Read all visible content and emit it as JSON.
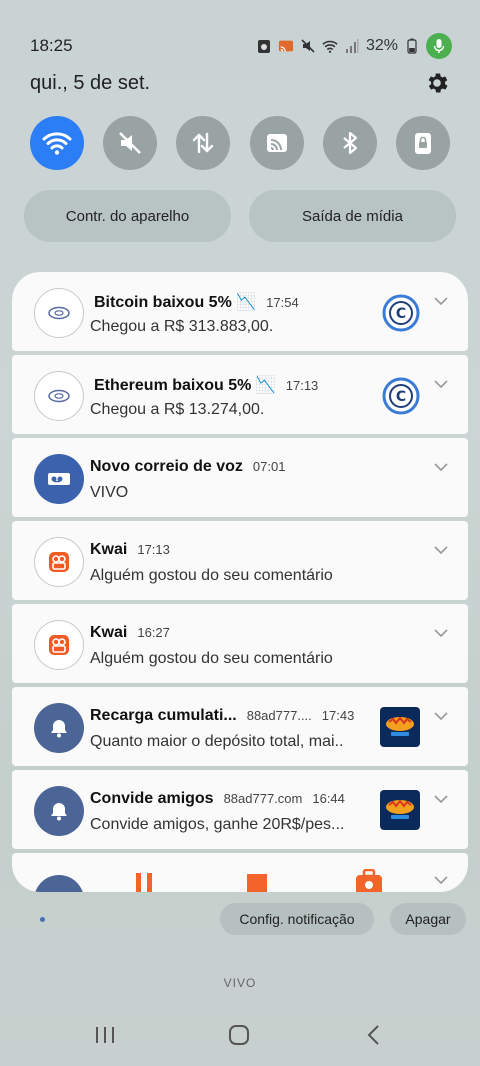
{
  "status": {
    "time": "18:25",
    "battery": "32%",
    "colors": {
      "mic": "#4caf50"
    }
  },
  "header": {
    "date": "qui., 5 de set."
  },
  "quick_settings": {
    "tiles": [
      {
        "name": "wifi",
        "active": true
      },
      {
        "name": "sound-off",
        "active": false
      },
      {
        "name": "mobile-data",
        "active": false
      },
      {
        "name": "cast",
        "active": false
      },
      {
        "name": "bluetooth",
        "active": false
      },
      {
        "name": "lock-rotation",
        "active": false
      }
    ],
    "device_control_label": "Contr. do aparelho",
    "media_output_label": "Saída de mídia"
  },
  "notifications": [
    {
      "title": "Bitcoin baixou 5% 📉",
      "time": "17:54",
      "body": "Chegou a R$ 313.883,00.",
      "icon": "coin-app-icon"
    },
    {
      "title": "Ethereum baixou 5% 📉",
      "time": "17:13",
      "body": "Chegou a R$ 13.274,00.",
      "icon": "coin-app-icon"
    },
    {
      "title": "Novo correio de voz",
      "time": "07:01",
      "body": "VIVO",
      "icon": "voicemail-icon"
    },
    {
      "title": "Kwai",
      "time": "17:13",
      "body": "Alguém gostou do seu comentário",
      "icon": "kwai-icon"
    },
    {
      "title": "Kwai",
      "time": "16:27",
      "body": "Alguém gostou do seu comentário",
      "icon": "kwai-icon"
    },
    {
      "title": "Recarga cumulati...",
      "source": "88ad777....",
      "time": "17:43",
      "body": "Quanto maior o depósito total, mai..",
      "icon": "bell-icon"
    },
    {
      "title": "Convide amigos",
      "source": "88ad777.com",
      "time": "16:44",
      "body": "Convide amigos, ganhe 20R$/pes...",
      "icon": "bell-icon"
    }
  ],
  "footer": {
    "notification_settings_label": "Config. notificação",
    "clear_label": "Apagar",
    "carrier": "VIVO"
  }
}
